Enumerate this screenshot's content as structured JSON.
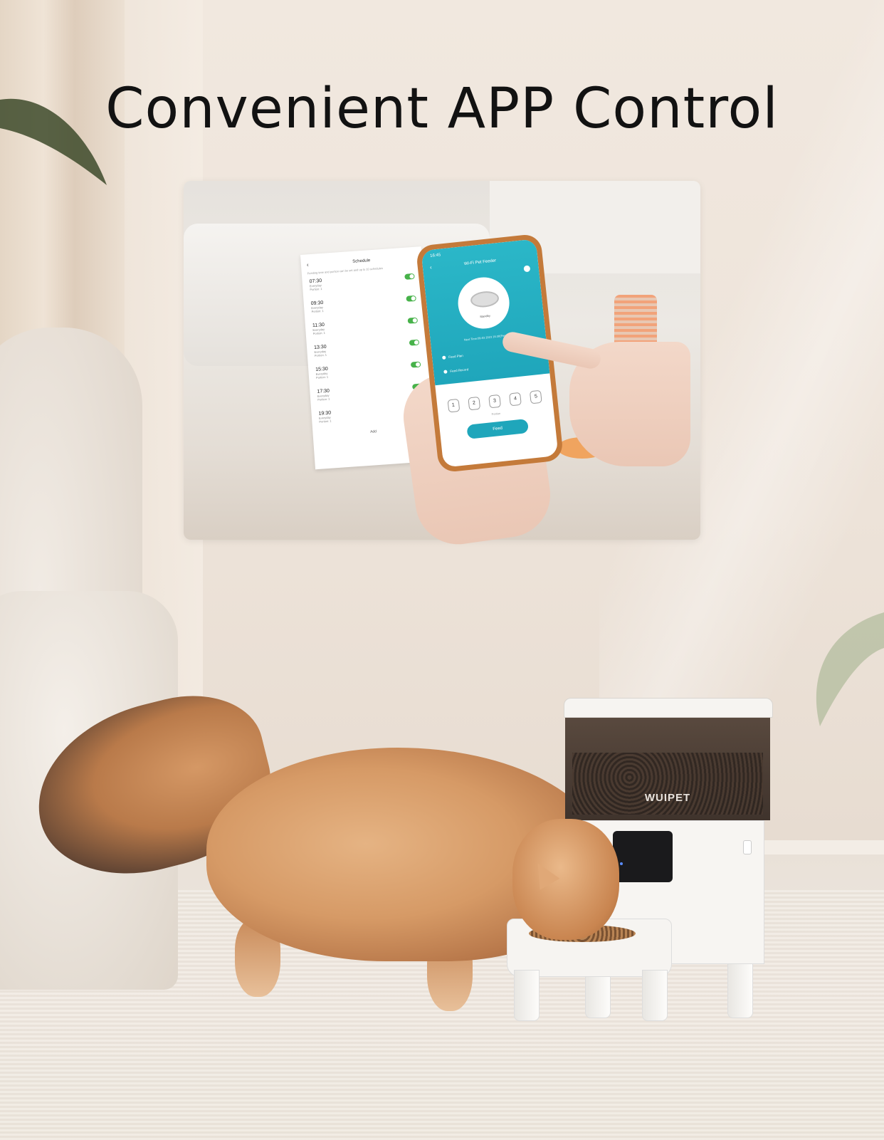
{
  "headline": "Convenient APP Control",
  "inset_photo": {
    "schedule_screen": {
      "title": "Schedule",
      "note": "Feeding time and portion can be set and up to 10 schedules",
      "entries": [
        {
          "time": "07:30",
          "repeat": "Everyday",
          "portion": "Portion: 1"
        },
        {
          "time": "09:30",
          "repeat": "Everyday",
          "portion": "Portion: 1"
        },
        {
          "time": "11:30",
          "repeat": "Everyday",
          "portion": "Portion: 1"
        },
        {
          "time": "13:30",
          "repeat": "Everyday",
          "portion": "Portion: 1"
        },
        {
          "time": "15:30",
          "repeat": "Everyday",
          "portion": "Portion: 1"
        },
        {
          "time": "17:30",
          "repeat": "Everyday",
          "portion": "Portion: 1"
        },
        {
          "time": "19:30",
          "repeat": "Everyday",
          "portion": "Portion: 1"
        }
      ],
      "add_label": "Add"
    },
    "phone_screen": {
      "status_time": "16:45",
      "title": "Wi-Fi Pet Feeder",
      "bowl_status": "Standby",
      "next_time": "Next Time:09-03 2023 16:30(Feeding)",
      "menu": [
        "Feed Plan",
        "Feed Record"
      ],
      "portions": [
        "1",
        "2",
        "3",
        "4",
        "5"
      ],
      "portion_label": "Portion",
      "feed_button": "Feed"
    }
  },
  "feeder": {
    "brand": "WUIPET"
  },
  "colors": {
    "app_teal": "#1fa6bb",
    "toggle_green": "#47b24a",
    "headline": "#121212"
  }
}
